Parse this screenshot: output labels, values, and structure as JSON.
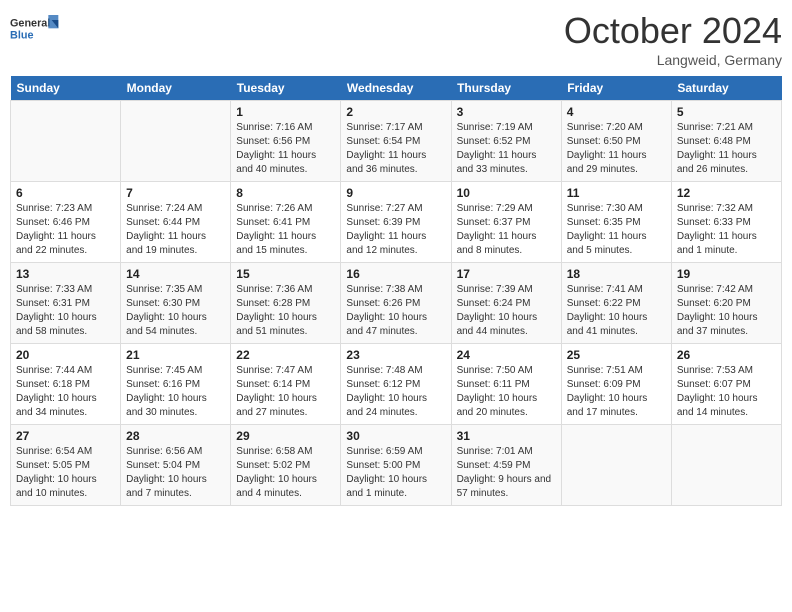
{
  "header": {
    "logo_general": "General",
    "logo_blue": "Blue",
    "month_title": "October 2024",
    "location": "Langweid, Germany"
  },
  "days_of_week": [
    "Sunday",
    "Monday",
    "Tuesday",
    "Wednesday",
    "Thursday",
    "Friday",
    "Saturday"
  ],
  "weeks": [
    [
      {
        "day": "",
        "sunrise": "",
        "sunset": "",
        "daylight": ""
      },
      {
        "day": "",
        "sunrise": "",
        "sunset": "",
        "daylight": ""
      },
      {
        "day": "1",
        "sunrise": "Sunrise: 7:16 AM",
        "sunset": "Sunset: 6:56 PM",
        "daylight": "Daylight: 11 hours and 40 minutes."
      },
      {
        "day": "2",
        "sunrise": "Sunrise: 7:17 AM",
        "sunset": "Sunset: 6:54 PM",
        "daylight": "Daylight: 11 hours and 36 minutes."
      },
      {
        "day": "3",
        "sunrise": "Sunrise: 7:19 AM",
        "sunset": "Sunset: 6:52 PM",
        "daylight": "Daylight: 11 hours and 33 minutes."
      },
      {
        "day": "4",
        "sunrise": "Sunrise: 7:20 AM",
        "sunset": "Sunset: 6:50 PM",
        "daylight": "Daylight: 11 hours and 29 minutes."
      },
      {
        "day": "5",
        "sunrise": "Sunrise: 7:21 AM",
        "sunset": "Sunset: 6:48 PM",
        "daylight": "Daylight: 11 hours and 26 minutes."
      }
    ],
    [
      {
        "day": "6",
        "sunrise": "Sunrise: 7:23 AM",
        "sunset": "Sunset: 6:46 PM",
        "daylight": "Daylight: 11 hours and 22 minutes."
      },
      {
        "day": "7",
        "sunrise": "Sunrise: 7:24 AM",
        "sunset": "Sunset: 6:44 PM",
        "daylight": "Daylight: 11 hours and 19 minutes."
      },
      {
        "day": "8",
        "sunrise": "Sunrise: 7:26 AM",
        "sunset": "Sunset: 6:41 PM",
        "daylight": "Daylight: 11 hours and 15 minutes."
      },
      {
        "day": "9",
        "sunrise": "Sunrise: 7:27 AM",
        "sunset": "Sunset: 6:39 PM",
        "daylight": "Daylight: 11 hours and 12 minutes."
      },
      {
        "day": "10",
        "sunrise": "Sunrise: 7:29 AM",
        "sunset": "Sunset: 6:37 PM",
        "daylight": "Daylight: 11 hours and 8 minutes."
      },
      {
        "day": "11",
        "sunrise": "Sunrise: 7:30 AM",
        "sunset": "Sunset: 6:35 PM",
        "daylight": "Daylight: 11 hours and 5 minutes."
      },
      {
        "day": "12",
        "sunrise": "Sunrise: 7:32 AM",
        "sunset": "Sunset: 6:33 PM",
        "daylight": "Daylight: 11 hours and 1 minute."
      }
    ],
    [
      {
        "day": "13",
        "sunrise": "Sunrise: 7:33 AM",
        "sunset": "Sunset: 6:31 PM",
        "daylight": "Daylight: 10 hours and 58 minutes."
      },
      {
        "day": "14",
        "sunrise": "Sunrise: 7:35 AM",
        "sunset": "Sunset: 6:30 PM",
        "daylight": "Daylight: 10 hours and 54 minutes."
      },
      {
        "day": "15",
        "sunrise": "Sunrise: 7:36 AM",
        "sunset": "Sunset: 6:28 PM",
        "daylight": "Daylight: 10 hours and 51 minutes."
      },
      {
        "day": "16",
        "sunrise": "Sunrise: 7:38 AM",
        "sunset": "Sunset: 6:26 PM",
        "daylight": "Daylight: 10 hours and 47 minutes."
      },
      {
        "day": "17",
        "sunrise": "Sunrise: 7:39 AM",
        "sunset": "Sunset: 6:24 PM",
        "daylight": "Daylight: 10 hours and 44 minutes."
      },
      {
        "day": "18",
        "sunrise": "Sunrise: 7:41 AM",
        "sunset": "Sunset: 6:22 PM",
        "daylight": "Daylight: 10 hours and 41 minutes."
      },
      {
        "day": "19",
        "sunrise": "Sunrise: 7:42 AM",
        "sunset": "Sunset: 6:20 PM",
        "daylight": "Daylight: 10 hours and 37 minutes."
      }
    ],
    [
      {
        "day": "20",
        "sunrise": "Sunrise: 7:44 AM",
        "sunset": "Sunset: 6:18 PM",
        "daylight": "Daylight: 10 hours and 34 minutes."
      },
      {
        "day": "21",
        "sunrise": "Sunrise: 7:45 AM",
        "sunset": "Sunset: 6:16 PM",
        "daylight": "Daylight: 10 hours and 30 minutes."
      },
      {
        "day": "22",
        "sunrise": "Sunrise: 7:47 AM",
        "sunset": "Sunset: 6:14 PM",
        "daylight": "Daylight: 10 hours and 27 minutes."
      },
      {
        "day": "23",
        "sunrise": "Sunrise: 7:48 AM",
        "sunset": "Sunset: 6:12 PM",
        "daylight": "Daylight: 10 hours and 24 minutes."
      },
      {
        "day": "24",
        "sunrise": "Sunrise: 7:50 AM",
        "sunset": "Sunset: 6:11 PM",
        "daylight": "Daylight: 10 hours and 20 minutes."
      },
      {
        "day": "25",
        "sunrise": "Sunrise: 7:51 AM",
        "sunset": "Sunset: 6:09 PM",
        "daylight": "Daylight: 10 hours and 17 minutes."
      },
      {
        "day": "26",
        "sunrise": "Sunrise: 7:53 AM",
        "sunset": "Sunset: 6:07 PM",
        "daylight": "Daylight: 10 hours and 14 minutes."
      }
    ],
    [
      {
        "day": "27",
        "sunrise": "Sunrise: 6:54 AM",
        "sunset": "Sunset: 5:05 PM",
        "daylight": "Daylight: 10 hours and 10 minutes."
      },
      {
        "day": "28",
        "sunrise": "Sunrise: 6:56 AM",
        "sunset": "Sunset: 5:04 PM",
        "daylight": "Daylight: 10 hours and 7 minutes."
      },
      {
        "day": "29",
        "sunrise": "Sunrise: 6:58 AM",
        "sunset": "Sunset: 5:02 PM",
        "daylight": "Daylight: 10 hours and 4 minutes."
      },
      {
        "day": "30",
        "sunrise": "Sunrise: 6:59 AM",
        "sunset": "Sunset: 5:00 PM",
        "daylight": "Daylight: 10 hours and 1 minute."
      },
      {
        "day": "31",
        "sunrise": "Sunrise: 7:01 AM",
        "sunset": "Sunset: 4:59 PM",
        "daylight": "Daylight: 9 hours and 57 minutes."
      },
      {
        "day": "",
        "sunrise": "",
        "sunset": "",
        "daylight": ""
      },
      {
        "day": "",
        "sunrise": "",
        "sunset": "",
        "daylight": ""
      }
    ]
  ]
}
